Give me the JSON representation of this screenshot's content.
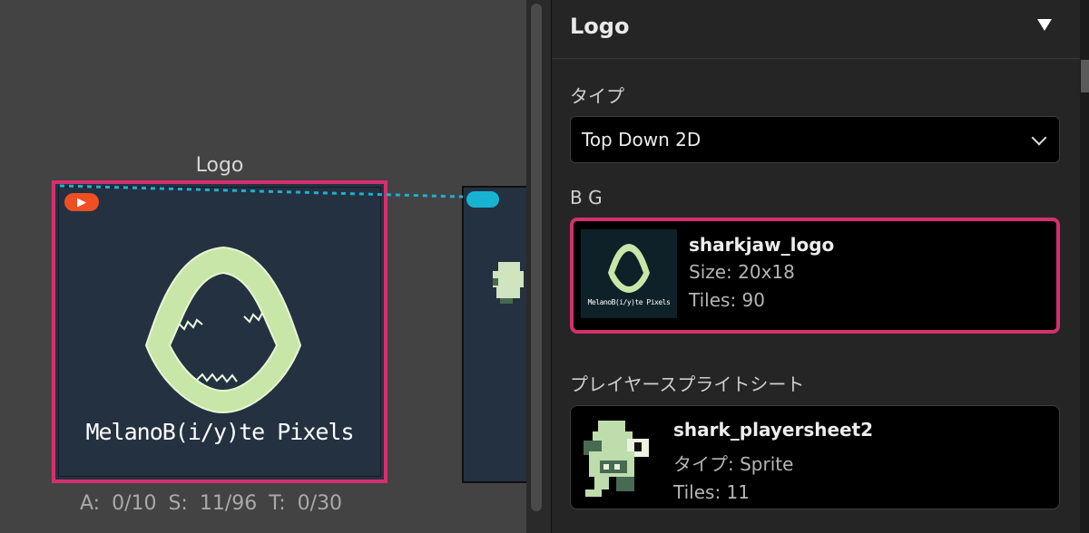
{
  "canvas": {
    "scene": {
      "title": "Logo",
      "caption": "MelanoB(i/y)te Pixels",
      "stats": "A: 0/10   S: 11/96   T: 0/30",
      "start_badge_icon": "play-icon"
    },
    "colors": {
      "selection": "#d4306e",
      "scene_bg": "#243140",
      "start_badge": "#f04e23",
      "connector": "#18b3d3",
      "jaw": "#c8e6a8"
    }
  },
  "panel": {
    "title": "Logo",
    "type_label": "タイプ",
    "type_value": "Top Down 2D",
    "bg_label": "B G",
    "background": {
      "name": "sharkjaw_logo",
      "size": "Size:  20x18",
      "tiles": "Tiles:  90",
      "thumb_caption": "MelanoB(i/y)te Pixels"
    },
    "sprite_label": "プレイヤースプライトシート",
    "sprite": {
      "name": "shark_playersheet2",
      "type": "タイプ:  Sprite",
      "tiles": "Tiles:  11"
    }
  }
}
